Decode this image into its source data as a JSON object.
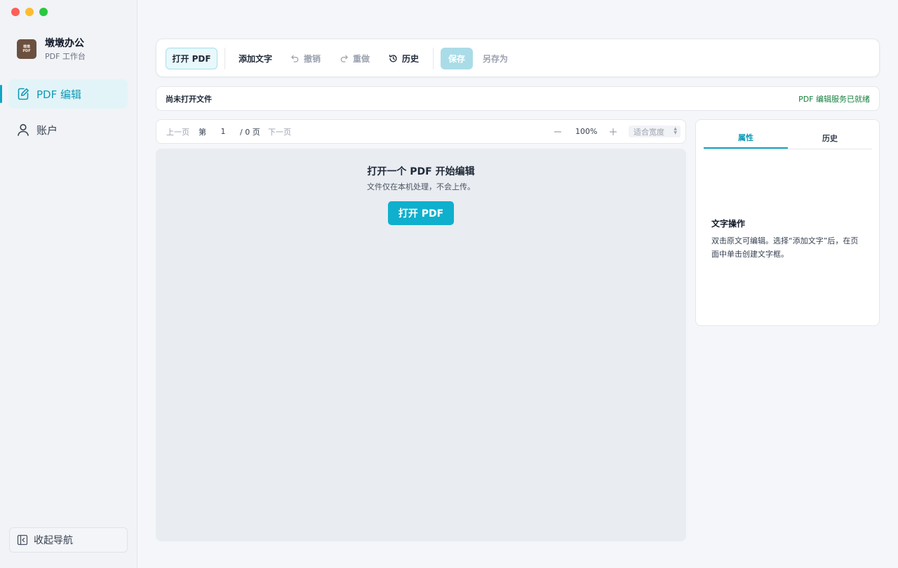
{
  "brand": {
    "logo_text": "墩墩PDF",
    "name": "墩墩办公",
    "subtitle": "PDF 工作台"
  },
  "sidebar": {
    "items": [
      {
        "label": "PDF 编辑",
        "icon": "edit-document-icon",
        "active": true
      },
      {
        "label": "账户",
        "icon": "user-icon",
        "active": false
      }
    ],
    "collapse_label": "收起导航"
  },
  "toolbar": {
    "open_label": "打开 PDF",
    "add_text_label": "添加文字",
    "undo_label": "撤销",
    "redo_label": "重做",
    "history_label": "历史",
    "save_label": "保存",
    "save_as_label": "另存为"
  },
  "info": {
    "file_status": "尚未打开文件",
    "service_status": "PDF 编辑服务已就绪"
  },
  "pager": {
    "prev_label": "上一页",
    "page_prefix": "第",
    "current_page": "1",
    "total_label": "/ 0 页",
    "next_label": "下一页",
    "zoom_level": "100%",
    "fit_mode": "适合宽度"
  },
  "empty_state": {
    "title": "打开一个 PDF 开始编辑",
    "subtitle": "文件仅在本机处理，不会上传。",
    "button_label": "打开 PDF"
  },
  "panel": {
    "tabs": [
      "属性",
      "历史"
    ],
    "active_tab": "属性",
    "title": "文字操作",
    "description": "双击原文可编辑。选择“添加文字”后，在页面中单击创建文字框。"
  },
  "colors": {
    "accent": "#0eb0cd",
    "status_green": "#15803d",
    "save_disabled": "#a9dce7"
  }
}
